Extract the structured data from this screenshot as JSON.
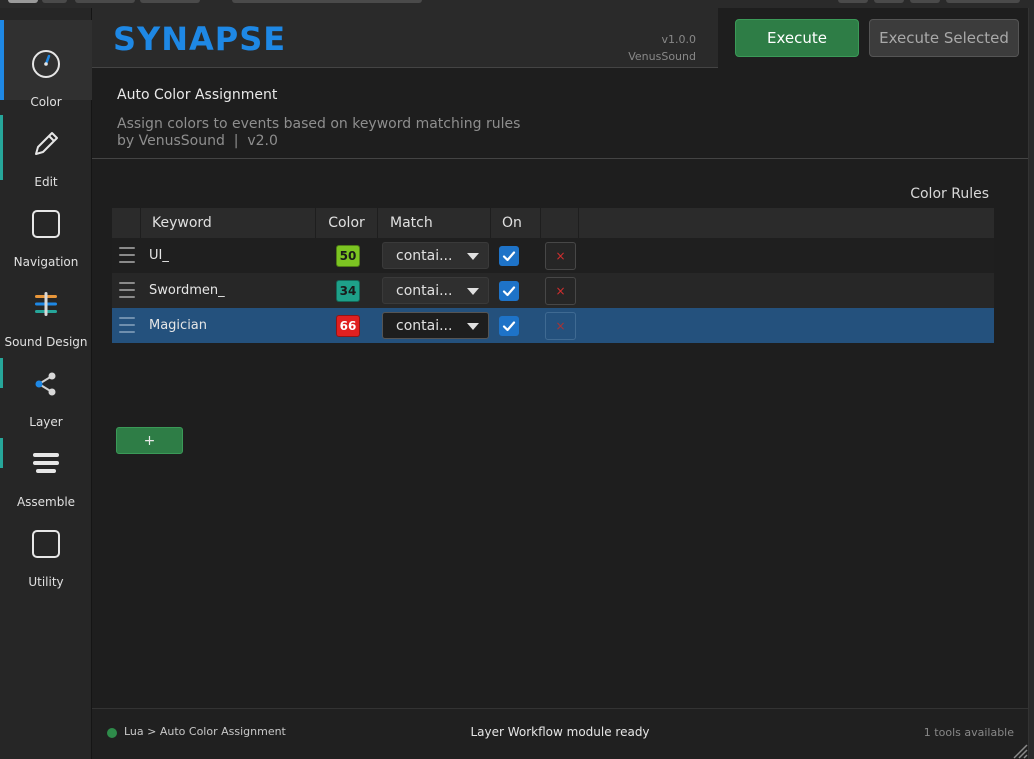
{
  "app": {
    "logo": "SYNAPSE",
    "version": "v1.0.0",
    "vendor": "VenusSound"
  },
  "colors": {
    "accent": "#1e88e5",
    "execute": "#2e7d46",
    "selected_row": "#24517d",
    "teal": "#26a69a"
  },
  "sidebar": {
    "items": [
      {
        "label": "Color",
        "icon": "color-dial-icon",
        "active": true
      },
      {
        "label": "Edit",
        "icon": "pencil-icon",
        "active": false
      },
      {
        "label": "Navigation",
        "icon": "square-icon",
        "active": false
      },
      {
        "label": "Sound Design",
        "icon": "sliders-icon",
        "active": false
      },
      {
        "label": "Layer",
        "icon": "share-nodes-icon",
        "active": false
      },
      {
        "label": "Assemble",
        "icon": "stack-lines-icon",
        "active": false
      },
      {
        "label": "Utility",
        "icon": "square-icon",
        "active": false
      }
    ]
  },
  "toolbar": {
    "execute_label": "Execute",
    "execute_selected_label": "Execute Selected"
  },
  "module": {
    "title": "Auto Color Assignment",
    "description": "Assign colors to events based on keyword matching rules",
    "byline": "by VenusSound  |  v2.0"
  },
  "rules": {
    "section_label": "Color Rules",
    "columns": [
      "Keyword",
      "Color",
      "Match",
      "On"
    ],
    "rows": [
      {
        "keyword": "UI_",
        "color_num": "50",
        "color_hex": "#7cc422",
        "text_color": "#1a1a1a",
        "match": "contai...",
        "on": true,
        "selected": false
      },
      {
        "keyword": "Swordmen_",
        "color_num": "34",
        "color_hex": "#1ea089",
        "text_color": "#1a1a1a",
        "match": "contai...",
        "on": true,
        "selected": false
      },
      {
        "keyword": "Magician",
        "color_num": "66",
        "color_hex": "#e02020",
        "text_color": "#ffffff",
        "match": "contai...",
        "on": true,
        "selected": true
      }
    ],
    "add_label": "+",
    "delete_glyph": "×"
  },
  "status": {
    "breadcrumb": "Lua > Auto Color Assignment",
    "message": "Layer Workflow module ready",
    "tools_count": "1 tools available"
  }
}
